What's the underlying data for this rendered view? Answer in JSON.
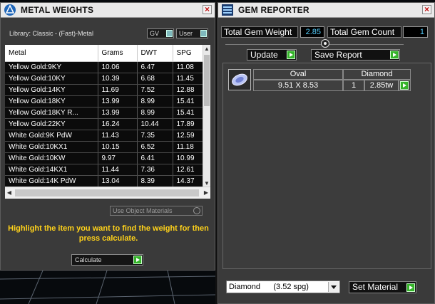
{
  "metal_weights": {
    "title": "METAL WEIGHTS",
    "library": "Library: Classic - (Fast)-Metal",
    "toggle_gv": "GV",
    "toggle_user": "User",
    "columns": [
      "Metal",
      "Grams",
      "DWT",
      "SPG"
    ],
    "rows": [
      [
        "Yellow Gold:9KY",
        "10.06",
        "6.47",
        "11.08"
      ],
      [
        "Yellow Gold:10KY",
        "10.39",
        "6.68",
        "11.45"
      ],
      [
        "Yellow Gold:14KY",
        "11.69",
        "7.52",
        "12.88"
      ],
      [
        "Yellow Gold:18KY",
        "13.99",
        "8.99",
        "15.41"
      ],
      [
        "Yellow Gold:18KY R...",
        "13.99",
        "8.99",
        "15.41"
      ],
      [
        "Yellow Gold:22KY",
        "16.24",
        "10.44",
        "17.89"
      ],
      [
        "White Gold:9K PdW",
        "11.43",
        "7.35",
        "12.59"
      ],
      [
        "White Gold:10KX1",
        "10.15",
        "6.52",
        "11.18"
      ],
      [
        "White Gold:10KW",
        "9.97",
        "6.41",
        "10.99"
      ],
      [
        "White Gold:14KX1",
        "11.44",
        "7.36",
        "12.61"
      ],
      [
        "White Gold:14K PdW",
        "13.04",
        "8.39",
        "14.37"
      ]
    ],
    "use_object_materials": "Use Object Materials",
    "help_text": "Highlight the item you want to find the weight for then press calculate.",
    "calculate_label": "Calculate"
  },
  "gem_reporter": {
    "title": "GEM REPORTER",
    "total_gem_weight_label": "Total Gem Weight",
    "total_gem_weight": "2.85",
    "total_gem_count_label": "Total Gem Count",
    "total_gem_count": "1",
    "update_label": "Update",
    "save_report_label": "Save Report",
    "gem": {
      "shape": "Oval",
      "material": "Diamond",
      "size": "9.51 X 8.53",
      "count": "1",
      "weight": "2.85tw"
    },
    "material_select": "Diamond      (3.52 spg)",
    "set_material_label": "Set Material"
  },
  "colors": {
    "panel_bg": "#3a3a3a",
    "title_bar": "#e9e9e9",
    "help_yellow": "#ffd21a",
    "value_blue": "#56d0ff",
    "go_green": "#35b32a"
  }
}
